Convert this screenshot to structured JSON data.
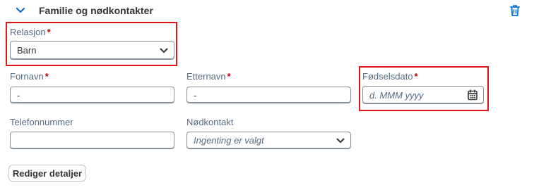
{
  "section": {
    "title": "Familie og nødkontakter"
  },
  "fields": {
    "relasjon": {
      "label": "Relasjon",
      "required": "*",
      "value": "Barn"
    },
    "fornavn": {
      "label": "Fornavn",
      "required": "*",
      "value": "-"
    },
    "etternavn": {
      "label": "Etternavn",
      "required": "*",
      "value": "-"
    },
    "fodselsdato": {
      "label": "Fødselsdato",
      "required": "*",
      "placeholder": "d. MMM yyyy"
    },
    "telefonnummer": {
      "label": "Telefonnummer",
      "value": ""
    },
    "nodkontakt": {
      "label": "Nødkontakt",
      "value": "Ingenting er valgt"
    }
  },
  "buttons": {
    "edit_details": "Rediger detaljer"
  },
  "colors": {
    "accent": "#0a6ed1",
    "required": "#bb0000",
    "highlight": "#e0161a"
  }
}
